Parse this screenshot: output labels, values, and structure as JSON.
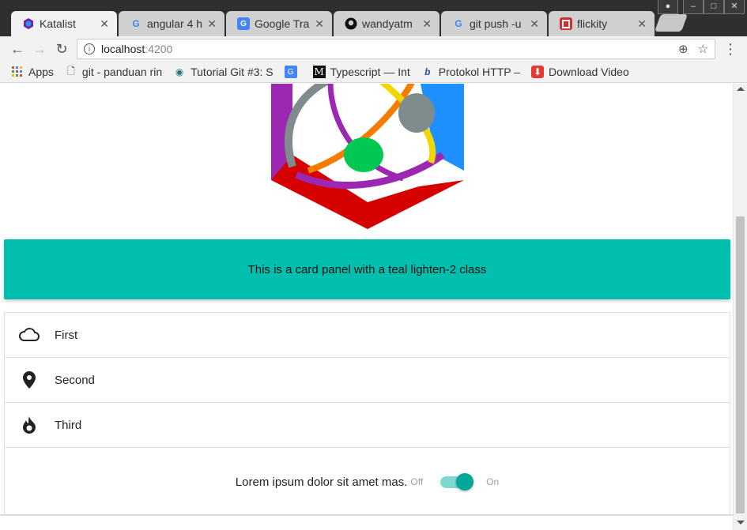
{
  "browser": {
    "tabs": [
      {
        "title": "Katalist",
        "active": true,
        "icon": "katalist-logo-icon",
        "color": "#7b1fa2"
      },
      {
        "title": "angular 4 h",
        "active": false,
        "icon": "google-icon",
        "color": "#4285f4"
      },
      {
        "title": "Google Tra",
        "active": false,
        "icon": "google-translate-icon",
        "color": "#4285f4"
      },
      {
        "title": "wandyatm",
        "active": false,
        "icon": "github-icon",
        "color": "#111111"
      },
      {
        "title": "git push -u",
        "active": false,
        "icon": "google-icon",
        "color": "#4285f4"
      },
      {
        "title": "flickity",
        "active": false,
        "icon": "flickity-icon",
        "color": "#d32f2f"
      }
    ],
    "address": {
      "host": "localhost",
      "port": ":4200"
    },
    "bookmarks": [
      {
        "label": "Apps",
        "icon": "apps-grid-icon"
      },
      {
        "label": "git - panduan rin",
        "icon": "page-icon"
      },
      {
        "label": "Tutorial Git #3: S",
        "icon": "globe-icon"
      },
      {
        "label": "",
        "icon": "google-translate-icon"
      },
      {
        "label": "Typescript — Int",
        "icon": "medium-icon"
      },
      {
        "label": "Protokol HTTP –",
        "icon": "bold-b-icon"
      },
      {
        "label": "Download Video",
        "icon": "download-icon"
      }
    ]
  },
  "page": {
    "card_panel_text": "This is a card panel with a teal lighten-2 class",
    "collection": [
      {
        "label": "First",
        "icon": "cloud-icon"
      },
      {
        "label": "Second",
        "icon": "location-pin-icon"
      },
      {
        "label": "Third",
        "icon": "flame-icon"
      }
    ],
    "switch": {
      "label": "Lorem ipsum dolor sit amet mas.",
      "off_label": "Off",
      "on_label": "On",
      "checked": true
    }
  },
  "colors": {
    "card_panel": "#00bfae",
    "switch_knob": "#00a89a",
    "switch_track": "#7fd8cf"
  }
}
